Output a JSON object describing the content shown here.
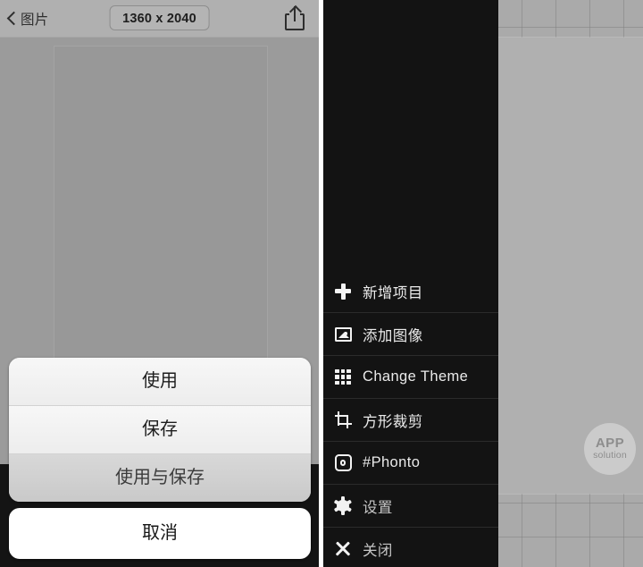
{
  "left_panel": {
    "navbar": {
      "back_label": "图片",
      "back_icon": "chevron-left-icon",
      "size_badge": "1360 x 2040",
      "share_icon": "share-icon"
    },
    "action_sheet": {
      "items": [
        {
          "label": "使用",
          "state": "normal"
        },
        {
          "label": "保存",
          "state": "normal"
        },
        {
          "label": "使用与保存",
          "state": "pressed"
        }
      ],
      "cancel_label": "取消"
    }
  },
  "right_panel": {
    "menu": {
      "items": [
        {
          "label": "新增项目",
          "icon": "plus-icon",
          "dim": false
        },
        {
          "label": "添加图像",
          "icon": "image-icon",
          "dim": false
        },
        {
          "label": "Change Theme",
          "icon": "grid-icon",
          "dim": false
        },
        {
          "label": "方形裁剪",
          "icon": "crop-icon",
          "dim": false
        },
        {
          "label": "#Phonto",
          "icon": "camera-icon",
          "dim": false
        },
        {
          "label": "设置",
          "icon": "gear-icon",
          "dim": true
        },
        {
          "label": "关闭",
          "icon": "close-icon",
          "dim": true
        }
      ]
    },
    "watermark": {
      "line1": "APP",
      "line2": "solution"
    }
  },
  "colors": {
    "left_bg": "#9a9a9a",
    "navbar_bg": "#b0b0b0",
    "sidebar_bg": "#131313",
    "grid_bg": "#aaaaaa",
    "canvas": "#b0b0b0",
    "sheet_bg": "#f2f2f2",
    "cancel_bg": "#ffffff"
  }
}
